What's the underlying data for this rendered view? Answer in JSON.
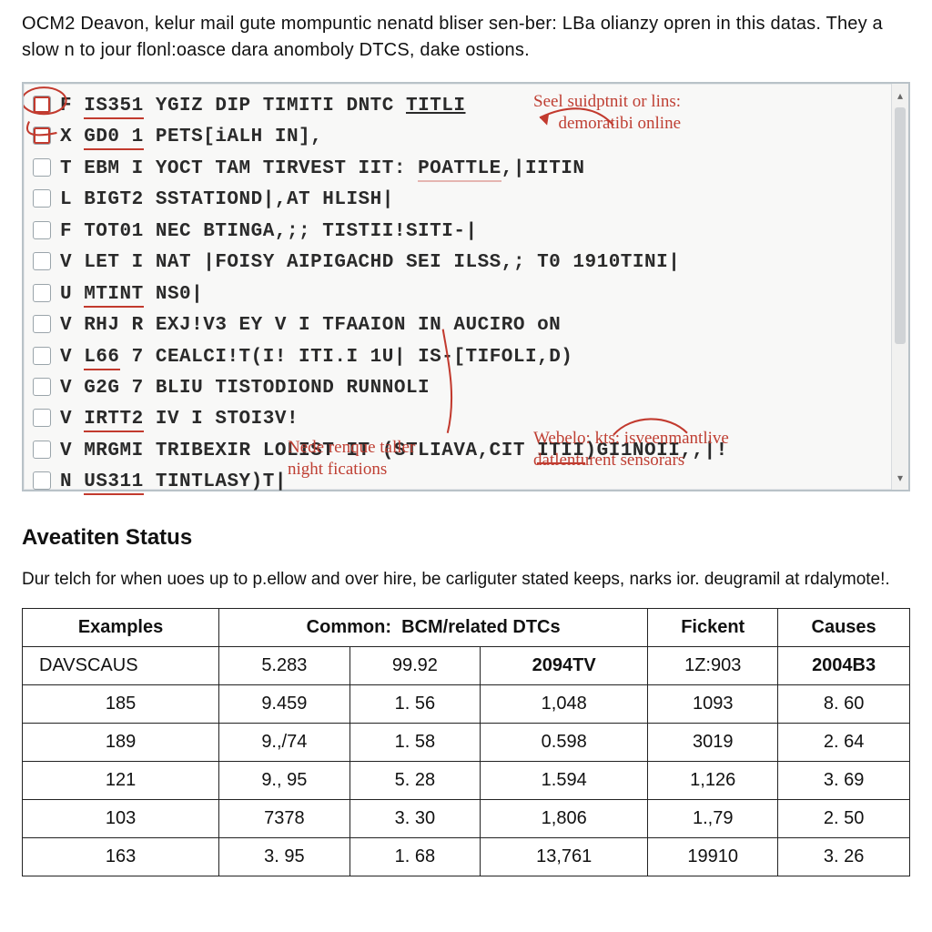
{
  "intro_text": "OCM2 Deavon, kelur mail gute mompuntic nenatd bliser sen-ber: LBa olianzy opren in this datas. They a slow n to jour flonl:oasce dara anomboly DTCS, dake ostions.",
  "listing": {
    "items": [
      {
        "checked": true,
        "text": "F IS351 YGIZ DIP TIMITI DNTC TITLI"
      },
      {
        "checked": true,
        "text": "X GD0 1 PETS[iALH IN],"
      },
      {
        "checked": false,
        "text": "T EBM I YOCT TAM TIRVEST IIT: POATTLE,|IITIN"
      },
      {
        "checked": false,
        "text": "L BIGT2 SSTATIOND|,AT HLISH|"
      },
      {
        "checked": false,
        "text": "F TOT01 NEC BTINGA,;; TISTII!SITI-|"
      },
      {
        "checked": false,
        "text": "V LET I NAT |FOISY AIPIGACHD SEI ILSS,; T0 1910TINI|"
      },
      {
        "checked": false,
        "text": "U MTINT NS0|"
      },
      {
        "checked": false,
        "text": "V RHJ R EXJ!V3 EY V I TFAAION IN AUCIRO oN"
      },
      {
        "checked": false,
        "text": "V L66 7 CEALCI!T(I! ITI.I 1U| IS-[TIFOLI,D)"
      },
      {
        "checked": false,
        "text": "V G2G 7 BLIU TISTODIOND RUNNOLI"
      },
      {
        "checked": false,
        "text": "V IRTT2 IV I STOI3V!"
      },
      {
        "checked": false,
        "text": "V MRGMI TRIBEXIR LOLIST IT (STLIAVA,CIT ITII)GI1NOII,,|!"
      },
      {
        "checked": false,
        "text": "N US311 TINTLASY)T|"
      }
    ],
    "annot_top_right_l1": "Seel suidptnit or lins:",
    "annot_top_right_l2": "demoratibi online",
    "annot_bot_mid_l1": "Nede renque taller",
    "annot_bot_mid_l2": "night fications",
    "annot_bot_right_l1": "Webelo: kts: isveenmantlive",
    "annot_bot_right_l2": "datlenturent sensorars"
  },
  "section_title": "Aveatiten Status",
  "section_sub": "Dur telch for when uoes up to p.ellow and over hire, be carliguter stated keeps, narks ior. deugramil at rdalymote!.",
  "table": {
    "headers": [
      "Examples",
      "Common:",
      "BCM/related DTCs",
      "",
      "Fickent",
      "Causes"
    ],
    "rows": [
      [
        "DAVSCAUS",
        "5.283",
        "99.92",
        "2094TV",
        "1Z:903",
        "2004B3"
      ],
      [
        "185",
        "9.459",
        "1. 56",
        "1,048",
        "1093",
        "8. 60"
      ],
      [
        "189",
        "9.,/74",
        "1. 58",
        "0.598",
        "3019",
        "2. 64"
      ],
      [
        "121",
        "9., 95",
        "5. 28",
        "1.594",
        "1,126",
        "3. 69"
      ],
      [
        "103",
        "7378",
        "3. 30",
        "1,806",
        "1.,79",
        "2. 50"
      ],
      [
        "163",
        "3. 95",
        "1. 68",
        "13,761",
        "19910",
        "3. 26"
      ]
    ]
  }
}
